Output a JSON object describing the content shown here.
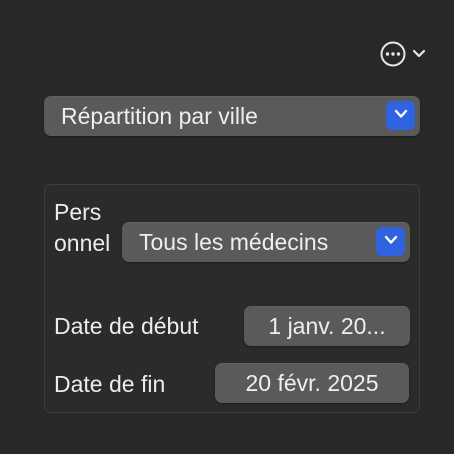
{
  "toolbar": {
    "more_icon": "ellipsis-circle-icon",
    "chevron_icon": "chevron-down-icon"
  },
  "view_selector": {
    "value": "Répartition par ville",
    "icon": "chevron-down-icon"
  },
  "filters": {
    "staff": {
      "label": "Personnel",
      "value": "Tous les médecins",
      "icon": "chevron-down-icon"
    },
    "start_date": {
      "label": "Date de début",
      "value": "1 janv. 20..."
    },
    "end_date": {
      "label": "Date de fin",
      "value": "20 févr. 2025"
    }
  },
  "colors": {
    "background": "#282828",
    "control": "#5a5a5a",
    "accent": "#2f63e0",
    "text": "#ececec"
  }
}
